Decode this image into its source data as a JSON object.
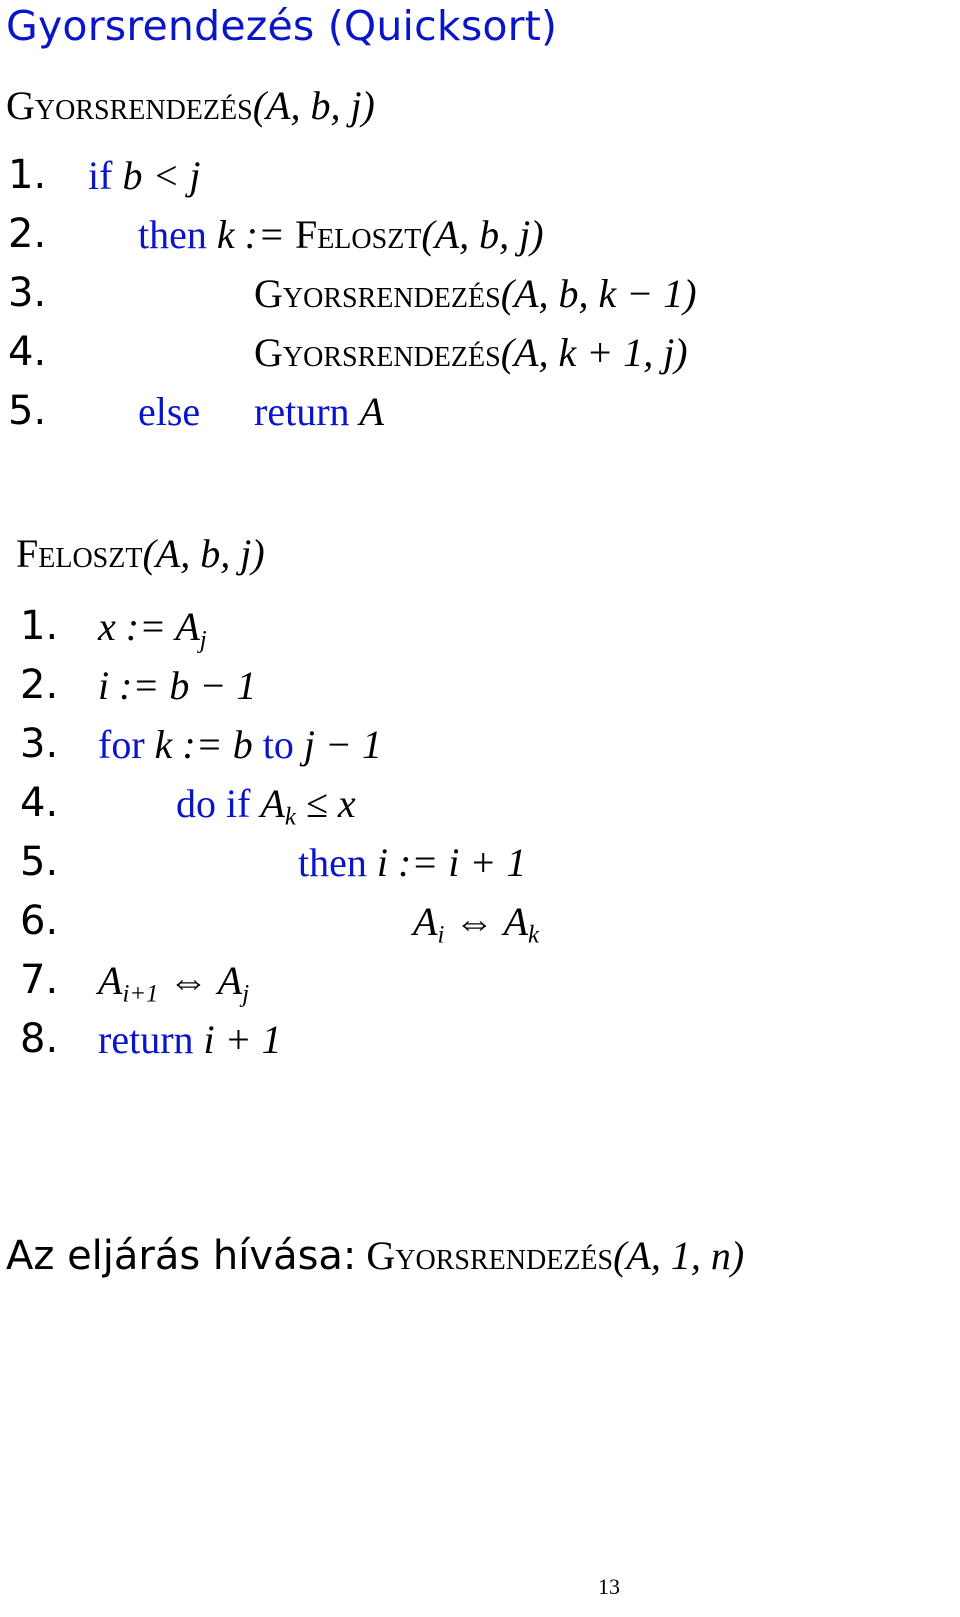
{
  "title": "Gyorsrendezés (Quicksort)",
  "quicksort": {
    "header": {
      "name": "Gyorsrendezés",
      "params": "(A, b, j)"
    },
    "lines": [
      {
        "num": "1.",
        "kw": "if",
        "expr": "b < j"
      },
      {
        "num": "2.",
        "kw": "then",
        "expr_pre": "k := ",
        "call": "Feloszt",
        "expr_post": "(A, b, j)"
      },
      {
        "num": "3.",
        "call": "Gyorsrendezés",
        "expr_post": "(A, b, k − 1)"
      },
      {
        "num": "4.",
        "call": "Gyorsrendezés",
        "expr_post": "(A, k + 1, j)"
      },
      {
        "num": "5.",
        "kw": "else",
        "kw2": "return",
        "expr": "A"
      }
    ]
  },
  "partition": {
    "header": {
      "name": "Feloszt",
      "params": "(A, b, j)"
    },
    "lines": [
      {
        "num": "1.",
        "expr": "x := A",
        "sub": "j"
      },
      {
        "num": "2.",
        "expr": "i := b − 1"
      },
      {
        "num": "3.",
        "kw": "for",
        "expr": "k := b",
        "kw2": "to",
        "expr2": "j − 1"
      },
      {
        "num": "4.",
        "kw": "do if",
        "expr": "A",
        "sub": "k",
        "expr2": " ≤ x"
      },
      {
        "num": "5.",
        "kw": "then",
        "expr": "i := i + 1"
      },
      {
        "num": "6.",
        "expr": "A",
        "sub": "i",
        "expr2": " ⇔ A",
        "sub2": "k"
      },
      {
        "num": "7.",
        "expr": "A",
        "sub": "i+1",
        "expr2": " ⇔ A",
        "sub2": "j"
      },
      {
        "num": "8.",
        "kw": "return",
        "expr": "i + 1"
      }
    ]
  },
  "call_line": {
    "label": "Az eljárás hívása:",
    "call": "Gyorsrendezés",
    "params": "(A, 1, n)"
  },
  "page_number": "13",
  "colors": {
    "keyword": "#0a14c8",
    "text": "#000000",
    "background": "#ffffff"
  }
}
